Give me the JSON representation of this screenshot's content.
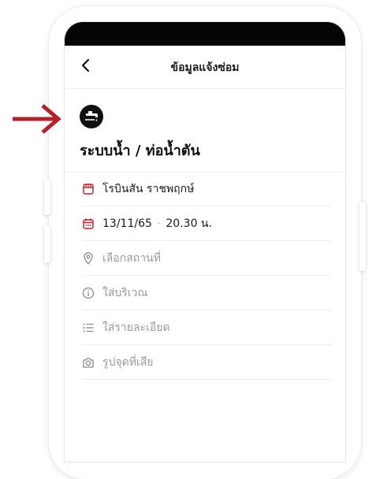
{
  "header": {
    "title": "ข้อมูลแจ้งซ่อม"
  },
  "category": {
    "title": "ระบบน้ำ / ท่อน้ำตัน",
    "icon": "faucet-icon"
  },
  "form": {
    "project": "โรบินสัน ราชพฤกษ์",
    "date": "13/11/65",
    "time": "20.30 น.",
    "location_placeholder": "เลือกสถานที่",
    "area_placeholder": "ใส่บริเวณ",
    "details_placeholder": "ใส่รายละเอียด",
    "photo_placeholder": "รูปจุดที่เสีย"
  },
  "colors": {
    "accent": "#b5202a",
    "icon_gray": "#8a8a8a",
    "dark": "#111111"
  }
}
